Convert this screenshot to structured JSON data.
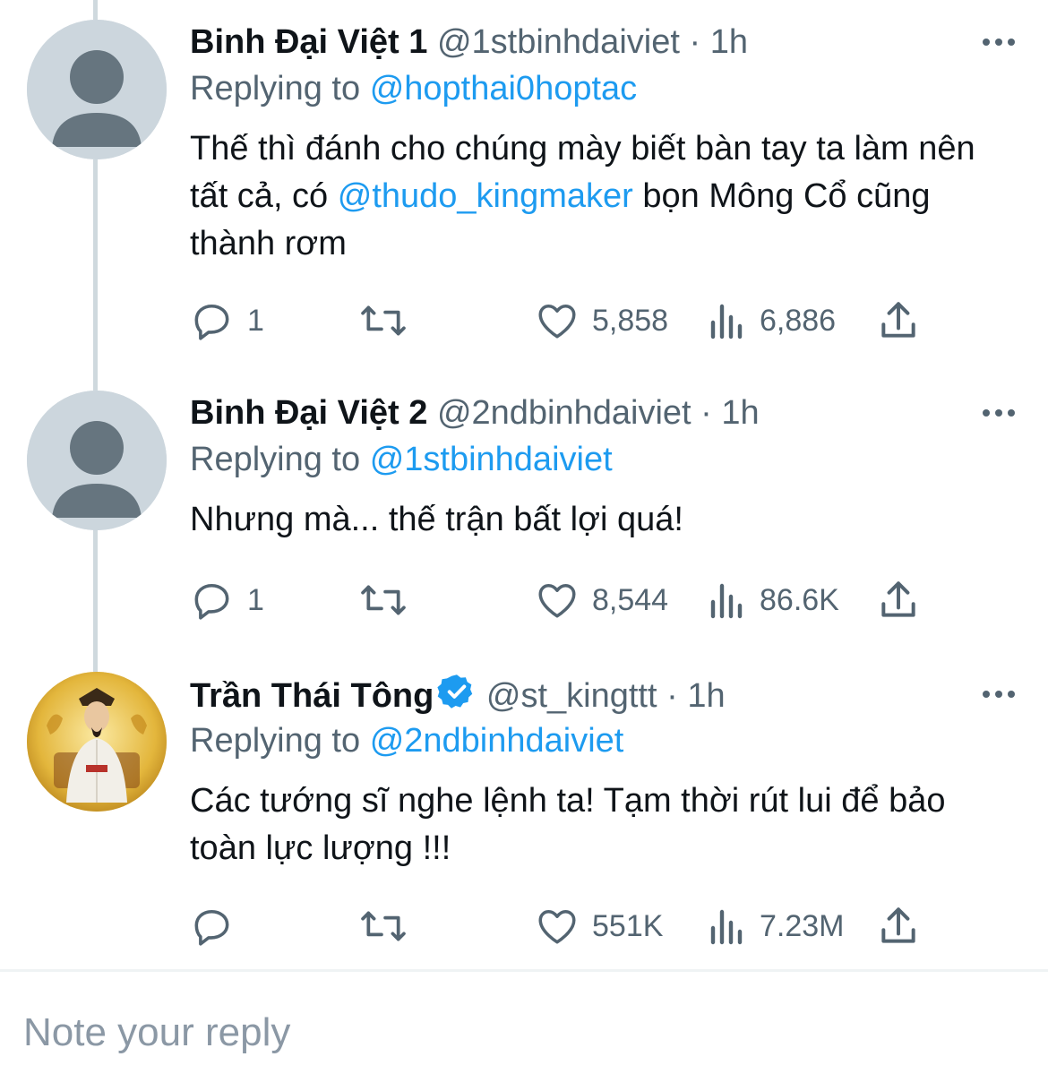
{
  "tweets": [
    {
      "name": "Binh Đại Việt 1",
      "handle": "@1stbinhdaiviet",
      "dot": "·",
      "time": "1h",
      "replying_label": "Replying to",
      "replying_to": "@hopthai0hoptac",
      "body_parts": [
        "Thế thì đánh cho chúng mày biết bàn tay ta làm nên tất cả, có ",
        "@thudo_kingmaker",
        " bọn Mông Cổ cũng thành rơm"
      ],
      "reply_count": "1",
      "like_count": "5,858",
      "view_count": "6,886",
      "avatar": "default-avatar"
    },
    {
      "name": "Binh Đại Việt 2",
      "handle": "@2ndbinhdaiviet",
      "dot": "·",
      "time": "1h",
      "replying_label": "Replying to",
      "replying_to": "@1stbinhdaiviet",
      "body_parts": [
        "Nhưng mà... thế trận bất lợi quá!",
        "",
        ""
      ],
      "reply_count": "1",
      "like_count": "8,544",
      "view_count": "86.6K",
      "avatar": "default-avatar"
    },
    {
      "name": "Trần Thái Tông",
      "handle": "@st_kingttt",
      "dot": "·",
      "time": "1h",
      "replying_label": "Replying to",
      "replying_to": "@2ndbinhdaiviet",
      "body_parts": [
        "Các tướng sĩ nghe lệnh ta! Tạm thời rút lui để bảo toàn lực lượng !!!",
        "",
        ""
      ],
      "reply_count": "",
      "like_count": "551K",
      "view_count": "7.23M",
      "avatar": "emperor-portrait",
      "verified": true
    }
  ],
  "reply_input": {
    "placeholder": "Note your reply"
  },
  "colors": {
    "link": "#1d9bf0",
    "muted": "#536471",
    "text": "#0f1419",
    "thread": "#cfd9de"
  },
  "icons": [
    "reply-icon",
    "retweet-icon",
    "like-icon",
    "views-icon",
    "share-icon",
    "more-icon",
    "verified-badge-icon"
  ]
}
